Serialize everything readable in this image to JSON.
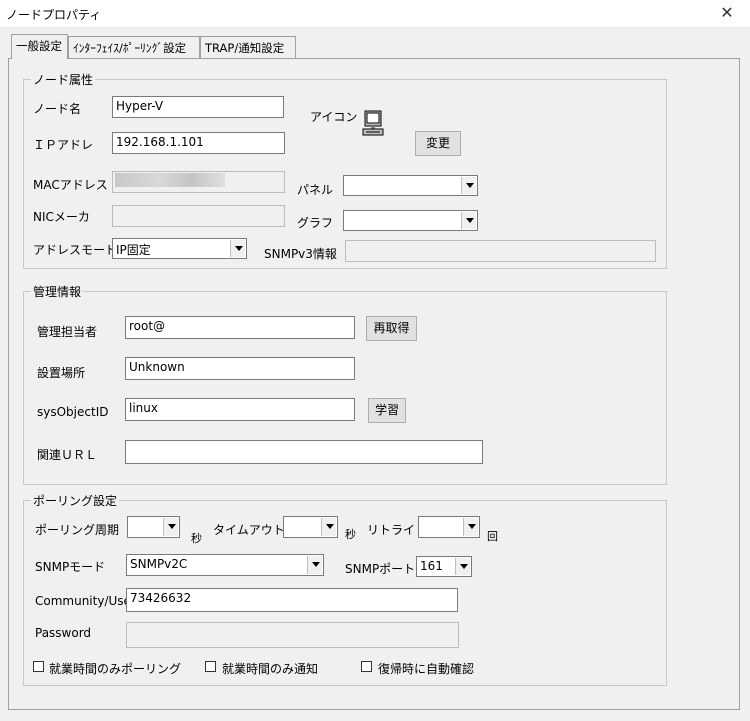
{
  "window": {
    "title": "ノードプロパティ",
    "close": "✕"
  },
  "tabs": [
    "一般設定",
    "ｲﾝﾀｰﾌｪｲｽ/ﾎﾟｰﾘﾝｸﾞ設定",
    "TRAP/通知設定"
  ],
  "node": {
    "group_title": "ノード属性",
    "name_label": "ノード名",
    "name_value": "Hyper-V",
    "ip_label": "ＩＰアドレ",
    "ip_value": "192.168.1.101",
    "mac_label": "MACアドレス",
    "nic_label": "NICメーカ",
    "addrmode_label": "アドレスモード",
    "addrmode_value": "IP固定",
    "icon_label": "アイコン",
    "change_button": "変更",
    "panel_label": "パネル",
    "graph_label": "グラフ",
    "snmpv3_label": "SNMPv3情報"
  },
  "mgmt": {
    "group_title": "管理情報",
    "contact_label": "管理担当者",
    "contact_value": "root@",
    "reacquire_button": "再取得",
    "location_label": "設置場所",
    "location_value": "Unknown",
    "sysobj_label": "sysObjectID",
    "sysobj_value": "linux",
    "learn_button": "学習",
    "url_label": "関連ＵＲＬ"
  },
  "polling": {
    "group_title": "ポーリング設定",
    "interval_label": "ポーリング周期",
    "sec1": "秒",
    "timeout_label": "タイムアウト",
    "sec2": "秒",
    "retry_label": "リトライ",
    "times": "回",
    "snmpmode_label": "SNMPモード",
    "snmpmode_value": "SNMPv2C",
    "snmpport_label": "SNMPポート",
    "snmpport_value": "161",
    "community_label": "Community/User",
    "community_value": "73426632",
    "password_label": "Password",
    "cb1_label": "就業時間のみポーリング",
    "cb2_label": "就業時間のみ通知",
    "cb3_label": "復帰時に自動確認"
  }
}
